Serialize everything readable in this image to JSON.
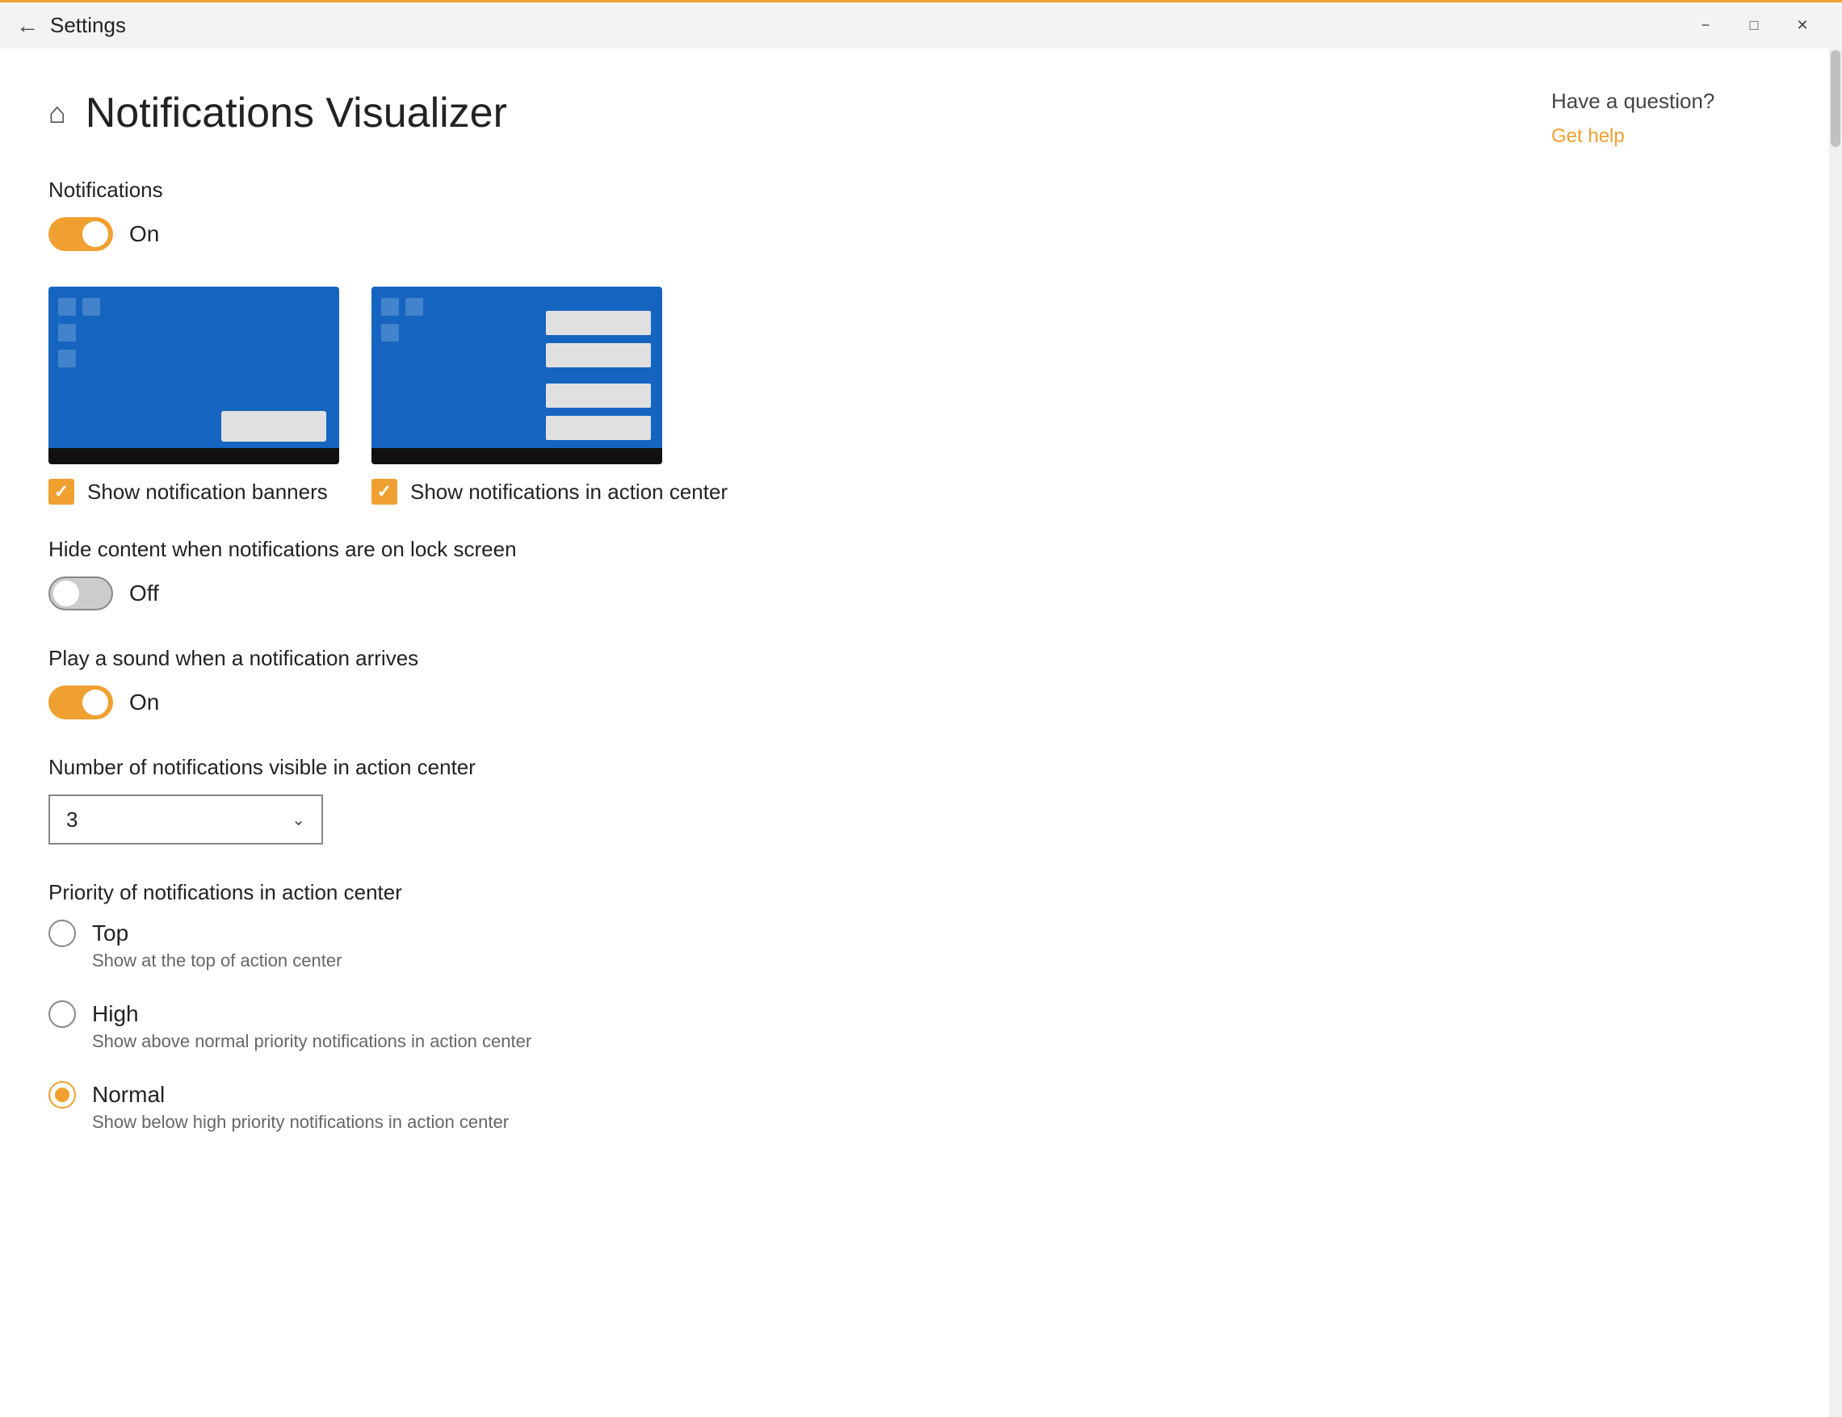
{
  "titlebar": {
    "app_name": "Settings",
    "minimize_label": "−",
    "maximize_label": "□",
    "close_label": "✕"
  },
  "page": {
    "home_icon": "⌂",
    "title": "Notifications Visualizer"
  },
  "right_panel": {
    "question": "Have a question?",
    "help_link": "Get help"
  },
  "notifications": {
    "section_label": "Notifications",
    "toggle_state": "on",
    "toggle_label": "On"
  },
  "checkboxes": {
    "banner": {
      "label": "Show notification banners",
      "checked": true
    },
    "action_center": {
      "label": "Show notifications in action center",
      "checked": true
    }
  },
  "hide_content": {
    "label": "Hide content when notifications are on lock screen",
    "toggle_state": "off",
    "toggle_label": "Off"
  },
  "play_sound": {
    "label": "Play a sound when a notification arrives",
    "toggle_state": "on",
    "toggle_label": "On"
  },
  "notification_count": {
    "label": "Number of notifications visible in action center",
    "value": "3"
  },
  "priority": {
    "label": "Priority of notifications in action center",
    "options": [
      {
        "label": "Top",
        "desc": "Show at the top of action center",
        "selected": false
      },
      {
        "label": "High",
        "desc": "Show above normal priority notifications in action center",
        "selected": false
      },
      {
        "label": "Normal",
        "desc": "Show below high priority notifications in action center",
        "selected": true
      }
    ]
  }
}
